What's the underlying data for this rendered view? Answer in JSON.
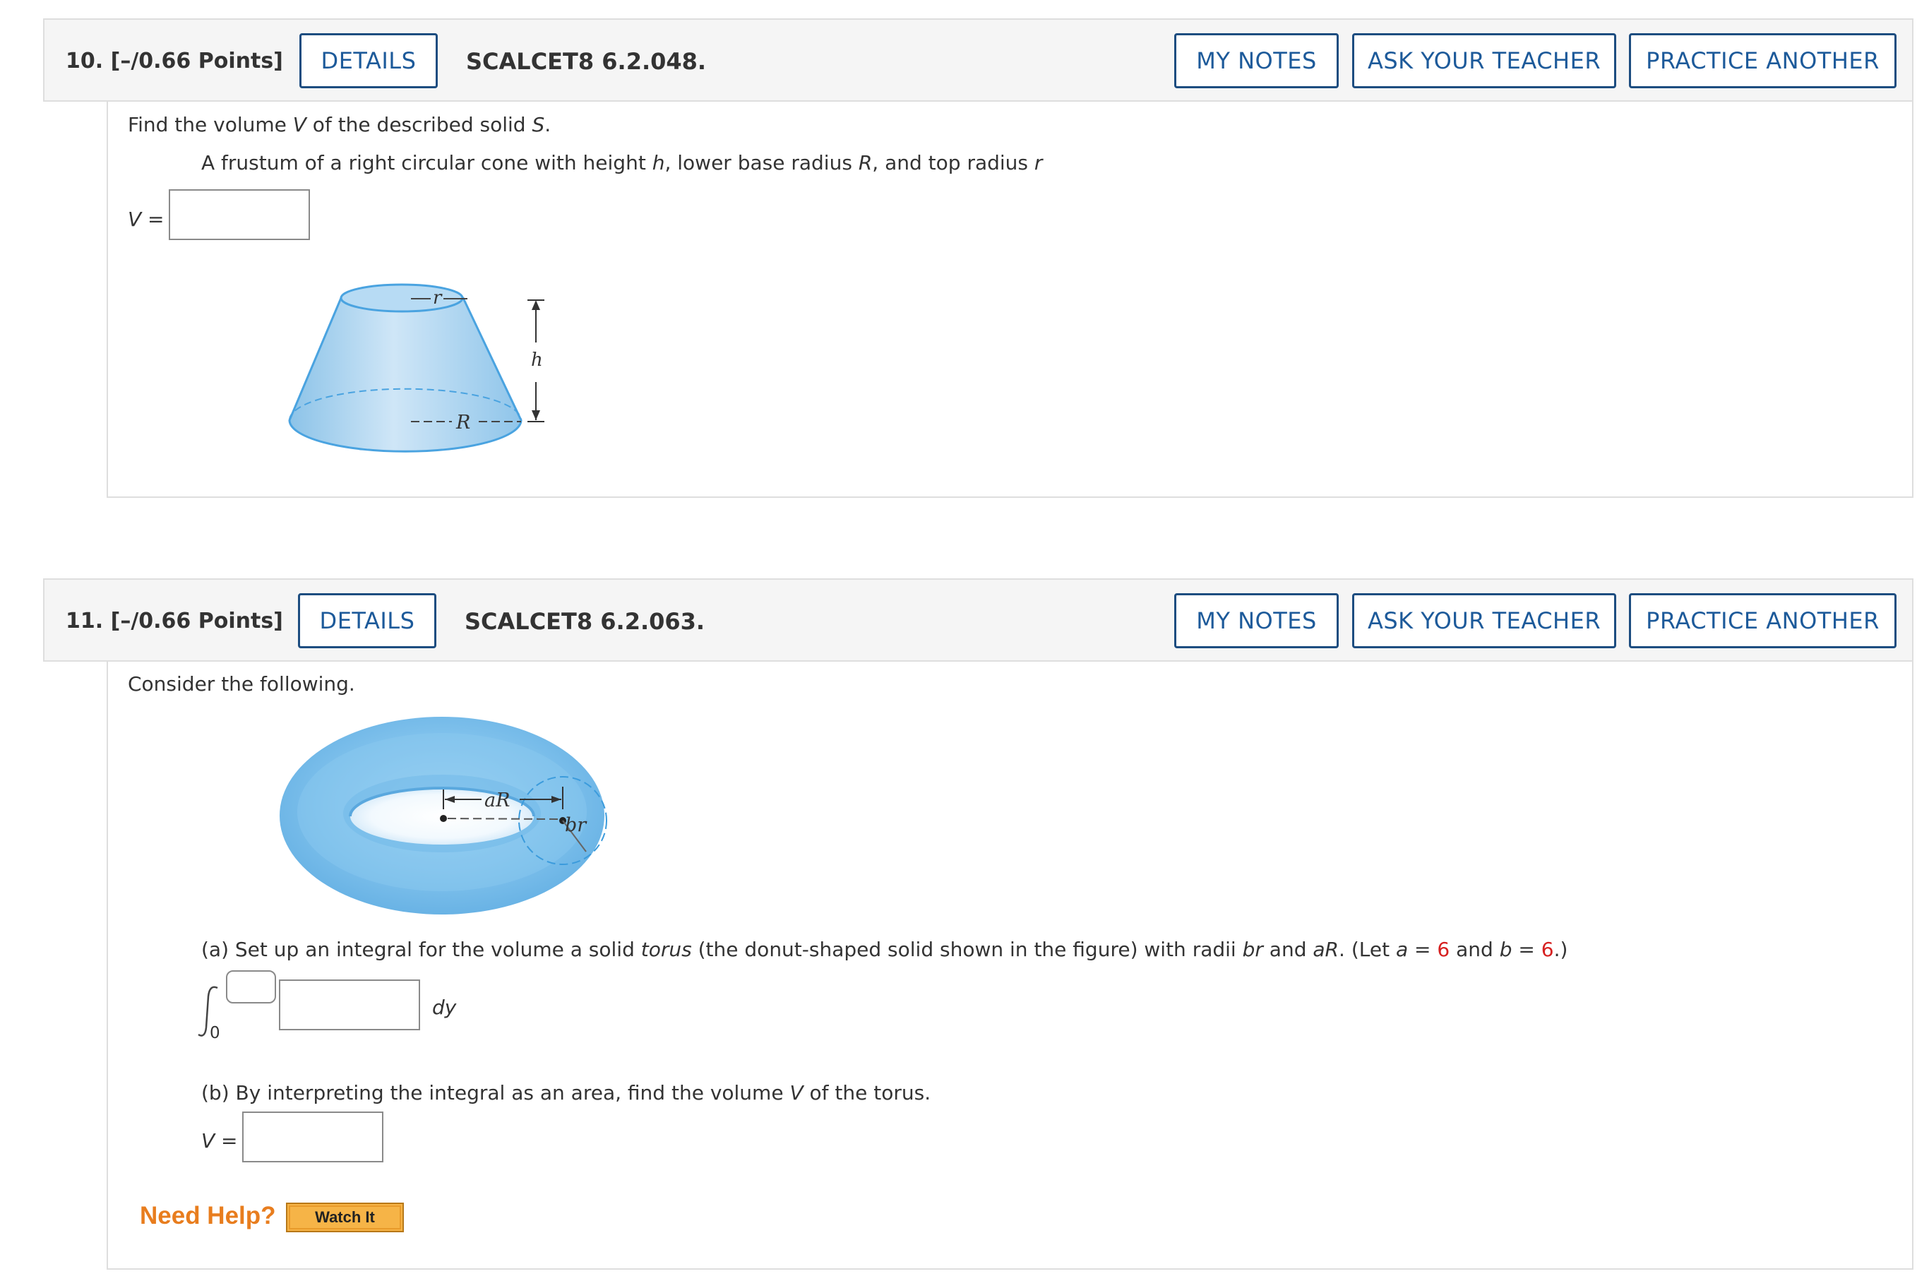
{
  "q10": {
    "number": "10.",
    "points": "[–/0.66 Points]",
    "details_label": "DETAILS",
    "code": "SCALCET8 6.2.048.",
    "my_notes_label": "MY NOTES",
    "ask_teacher_label": "ASK YOUR TEACHER",
    "practice_label": "PRACTICE ANOTHER",
    "prompt_pre": "Find the volume ",
    "prompt_v": "V",
    "prompt_mid": " of the described solid ",
    "prompt_s": "S",
    "prompt_end": ".",
    "desc_1": "A frustum of a right circular cone with height ",
    "desc_h": "h",
    "desc_2": ", lower base radius ",
    "desc_R": "R",
    "desc_3": ", and top radius ",
    "desc_r": "r",
    "answer_var": "V",
    "answer_eq": " =",
    "answer_value": "",
    "figure": {
      "label_r": "r",
      "label_h": "h",
      "label_R": "R"
    }
  },
  "q11": {
    "number": "11.",
    "points": "[–/0.66 Points]",
    "details_label": "DETAILS",
    "code": "SCALCET8 6.2.063.",
    "my_notes_label": "MY NOTES",
    "ask_teacher_label": "ASK YOUR TEACHER",
    "practice_label": "PRACTICE ANOTHER",
    "intro": "Consider the following.",
    "figure": {
      "label_aR": "aR",
      "label_br": "br"
    },
    "part_a_1": "(a) Set up an integral for the volume a solid ",
    "part_a_torus": "torus",
    "part_a_2": " (the donut-shaped solid shown in the figure) with radii ",
    "part_a_br": "br",
    "part_a_3": " and ",
    "part_a_aR": "aR",
    "part_a_4": ". (Let ",
    "part_a_a": "a",
    "part_a_5": " = ",
    "a_value": "6",
    "part_a_6": " and ",
    "part_a_b": "b",
    "part_a_7": " = ",
    "b_value": "6",
    "part_a_8": ".)",
    "integral_lower": "0",
    "integral_upper_value": "",
    "integrand_value": "",
    "integral_dvar": "dy",
    "part_b_1": "(b) By interpreting the integral as an area, find the volume ",
    "part_b_v": "V",
    "part_b_2": " of the torus.",
    "answer_var": "V",
    "answer_eq": " =",
    "answer_value": "",
    "need_help_label": "Need Help?",
    "watch_it_label": "Watch It"
  }
}
